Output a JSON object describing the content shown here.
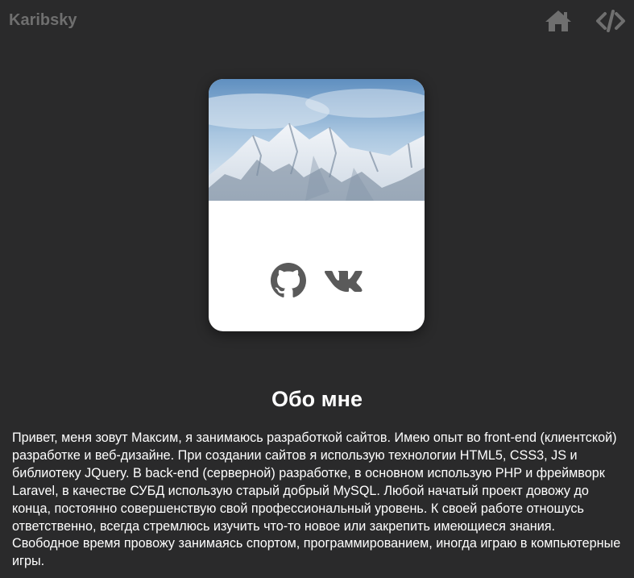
{
  "header": {
    "brand": "Karibsky",
    "nav": [
      {
        "icon": "home-icon"
      },
      {
        "icon": "code-icon"
      }
    ]
  },
  "card": {
    "image": "snowy-mountains",
    "social": [
      {
        "icon": "github-icon"
      },
      {
        "icon": "vk-icon"
      }
    ]
  },
  "about": {
    "title": "Обо мне",
    "text": "Привет, меня зовут Максим, я занимаюсь разработкой сайтов. Имею опыт во front-end (клиентской) разработке и веб-дизайне. При создании сайтов я использую технологии HTML5, CSS3, JS и библиотеку JQuery. В back-end (серверной) разработке, в основном использую PHP и фреймворк Laravel, в качестве СУБД использую старый добрый MySQL. Любой начатый проект довожу до конца, постоянно совершенствую свой профессиональный уровень. К своей работе отношусь ответственно, всегда стремлюсь изучить что-то новое или закрепить имеющиеся знания. Свободное время провожу занимаясь спортом, программированием, иногда играю в компьютерные игры."
  },
  "colors": {
    "background": "#2a2a2b",
    "muted": "#6f6f6f",
    "icon": "#5a5a5a",
    "card": "#ffffff"
  }
}
